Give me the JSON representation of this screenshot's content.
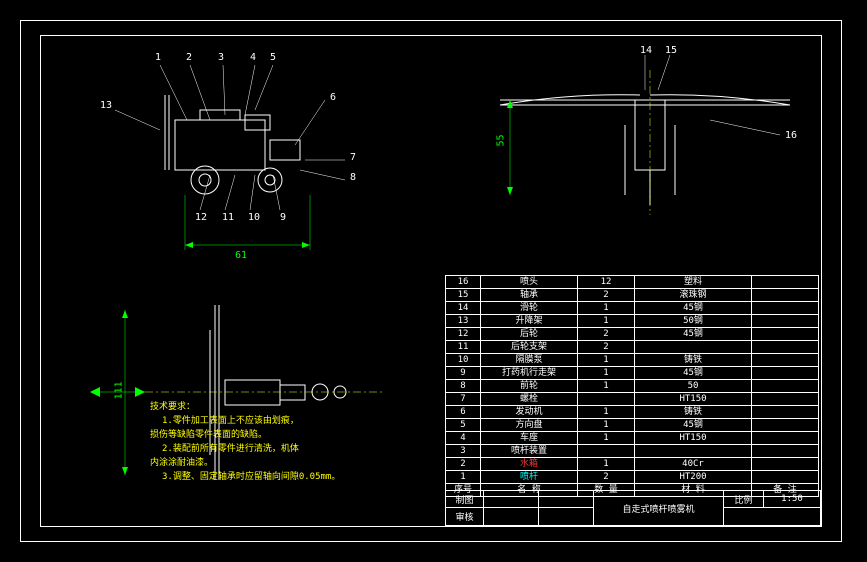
{
  "dimensions": {
    "width_main": "61",
    "height_side": "55",
    "height_bottom": "111"
  },
  "callouts_left_view": [
    "1",
    "2",
    "3",
    "4",
    "5",
    "6",
    "7",
    "8",
    "9",
    "10",
    "11",
    "12",
    "13"
  ],
  "callouts_right_view": [
    "14",
    "15",
    "16"
  ],
  "tech_notes": {
    "title": "技术要求：",
    "line1": "1.零件加工表面上不应该由划痕，",
    "line1b": "损伤等缺陷零件表面的缺陷。",
    "line2": "2.装配前所有零件进行清洗，机体",
    "line2b": "内涂涂耐油漆。",
    "line3": "3.调整、固定轴承时应留轴向间隙0.05mm。"
  },
  "parts": [
    {
      "no": "16",
      "name": "喷头",
      "qty": "12",
      "mat": "塑料",
      "note": ""
    },
    {
      "no": "15",
      "name": "轴承",
      "qty": "2",
      "mat": "滚珠钢",
      "note": ""
    },
    {
      "no": "14",
      "name": "滑轮",
      "qty": "1",
      "mat": "45钢",
      "note": ""
    },
    {
      "no": "13",
      "name": "升降架",
      "qty": "1",
      "mat": "50钢",
      "note": ""
    },
    {
      "no": "12",
      "name": "后轮",
      "qty": "2",
      "mat": "45钢",
      "note": ""
    },
    {
      "no": "11",
      "name": "后轮支架",
      "qty": "2",
      "mat": "",
      "note": ""
    },
    {
      "no": "10",
      "name": "隔膜泵",
      "qty": "1",
      "mat": "铸铁",
      "note": ""
    },
    {
      "no": "9",
      "name": "打药机行走架",
      "qty": "1",
      "mat": "45钢",
      "note": ""
    },
    {
      "no": "8",
      "name": "前轮",
      "qty": "1",
      "mat": "50",
      "note": ""
    },
    {
      "no": "7",
      "name": "螺栓",
      "qty": "",
      "mat": "HT150",
      "note": ""
    },
    {
      "no": "6",
      "name": "发动机",
      "qty": "1",
      "mat": "铸铁",
      "note": ""
    },
    {
      "no": "5",
      "name": "方向盘",
      "qty": "1",
      "mat": "45钢",
      "note": ""
    },
    {
      "no": "4",
      "name": "车座",
      "qty": "1",
      "mat": "HT150",
      "note": ""
    },
    {
      "no": "3",
      "name": "喷杆装置",
      "qty": "",
      "mat": "",
      "note": ""
    },
    {
      "no": "2",
      "name": "水箱",
      "qty": "1",
      "mat": "40Cr",
      "note": ""
    },
    {
      "no": "1",
      "name": "喷杆",
      "qty": "2",
      "mat": "HT200",
      "note": ""
    }
  ],
  "parts_header": {
    "no": "序号",
    "name": "名   称",
    "qty": "数  量",
    "mat": "材   料",
    "note": "备   注"
  },
  "title_block": {
    "row1_c1": "制图",
    "row1_c2": "",
    "row1_c3": "",
    "row1_title": "自走式喷杆喷雾机",
    "row1_scale_lbl": "比例",
    "row1_scale": "1:50",
    "row2_c1": "审核",
    "row2_c2": "",
    "row2_c3": ""
  },
  "header_row_label": {
    "c1": "",
    "c2": "",
    "c3": ""
  }
}
